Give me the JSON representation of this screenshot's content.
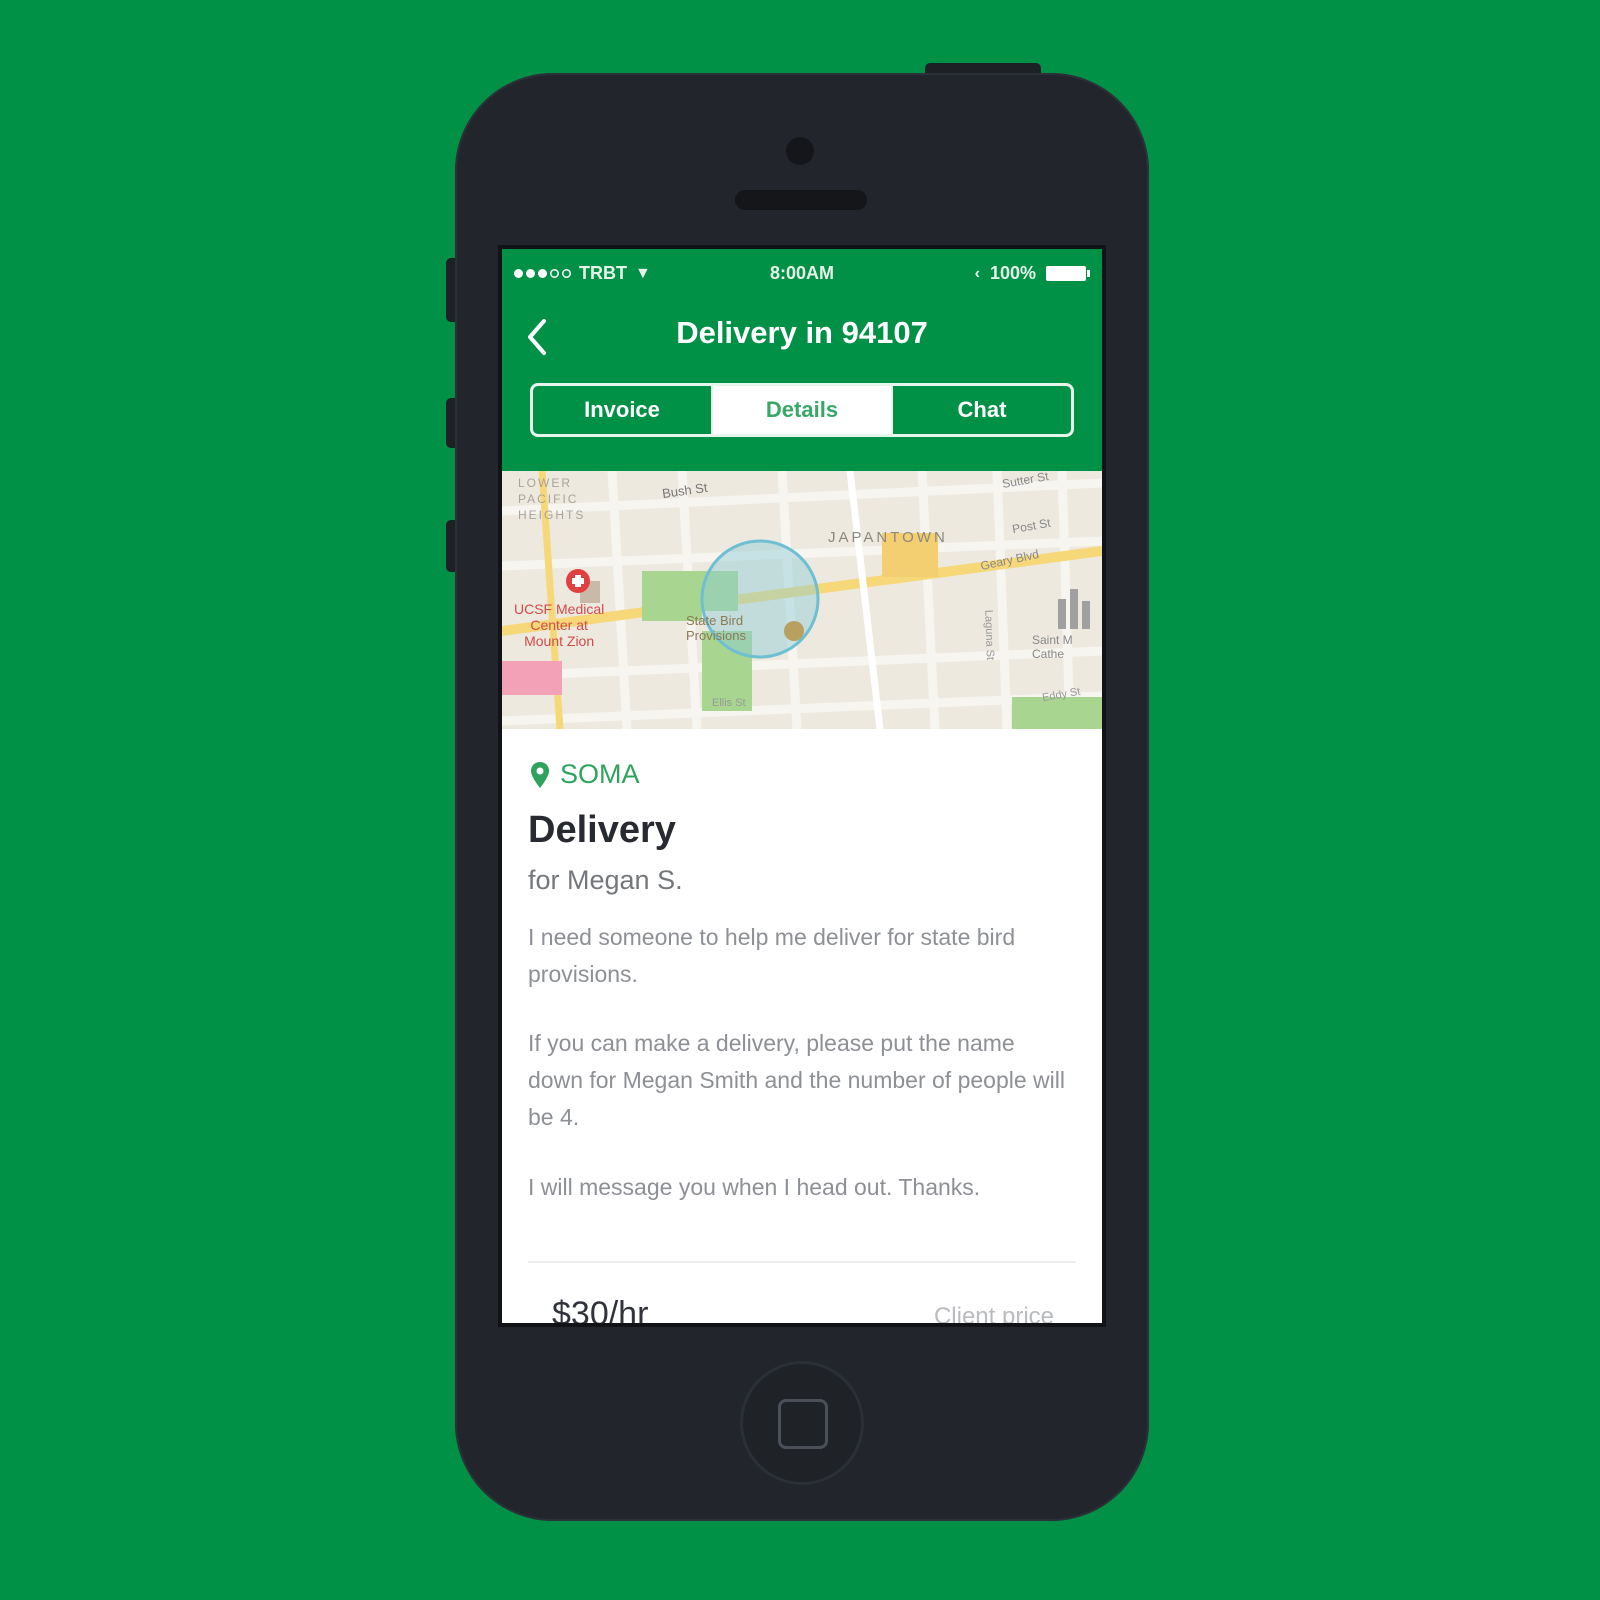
{
  "status_bar": {
    "carrier": "TRBT",
    "time": "8:00AM",
    "battery": "100%"
  },
  "nav": {
    "title": "Delivery in 94107"
  },
  "tabs": [
    {
      "label": "Invoice",
      "active": false
    },
    {
      "label": "Details",
      "active": true
    },
    {
      "label": "Chat",
      "active": false
    }
  ],
  "map": {
    "labels": {
      "lower_pacific_heights_1": "LOWER",
      "lower_pacific_heights_2": "PACIFIC",
      "lower_pacific_heights_3": "HEIGHTS",
      "bush_st": "Bush St",
      "sutter_st": "Sutter St",
      "post_st": "Post St",
      "japantown": "JAPANTOWN",
      "geary_blvd": "Geary Blvd",
      "ucsf_1": "UCSF Medical",
      "ucsf_2": "Center at",
      "ucsf_3": "Mount Zion",
      "state_bird_1": "State Bird",
      "state_bird_2": "Provisions",
      "ellis_st": "Ellis St",
      "eddy_st": "Eddy St",
      "laguna_st": "Laguna St",
      "saint_mary_1": "Saint M",
      "saint_mary_2": "Cathe"
    }
  },
  "job": {
    "location": "SOMA",
    "title": "Delivery",
    "client": "for Megan S.",
    "paragraphs": [
      "I need someone to help me deliver for state bird provisions.",
      "If you can make a delivery, please put the name down for Megan Smith and the number of people will be 4.",
      "I will message you when I head out. Thanks."
    ],
    "price": "$30/hr",
    "price_label": "Client price"
  },
  "colors": {
    "background": "#019146",
    "accent": "#2ea35e",
    "phone_body": "#22252b"
  }
}
